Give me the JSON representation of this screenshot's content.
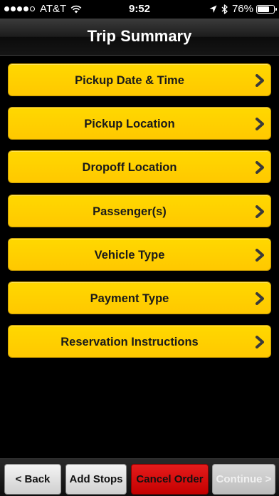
{
  "status_bar": {
    "carrier": "AT&T",
    "time": "9:52",
    "battery_percent": "76%",
    "battery_level": 0.76,
    "signal_bars_filled": 4,
    "signal_bars_total": 5
  },
  "nav": {
    "title": "Trip Summary"
  },
  "menu": {
    "items": [
      {
        "label": "Pickup Date & Time"
      },
      {
        "label": "Pickup Location"
      },
      {
        "label": "Dropoff Location"
      },
      {
        "label": "Passenger(s)"
      },
      {
        "label": "Vehicle Type"
      },
      {
        "label": "Payment Type"
      },
      {
        "label": "Reservation Instructions"
      }
    ]
  },
  "toolbar": {
    "back_label": "< Back",
    "add_stops_label": "Add Stops",
    "cancel_label": "Cancel Order",
    "continue_label": "Continue >",
    "continue_enabled": false
  },
  "colors": {
    "accent_yellow": "#FFD000",
    "cancel_red": "#D80000",
    "background": "#000000"
  },
  "icons": {
    "menu_chevron": "chevron-right-icon"
  }
}
